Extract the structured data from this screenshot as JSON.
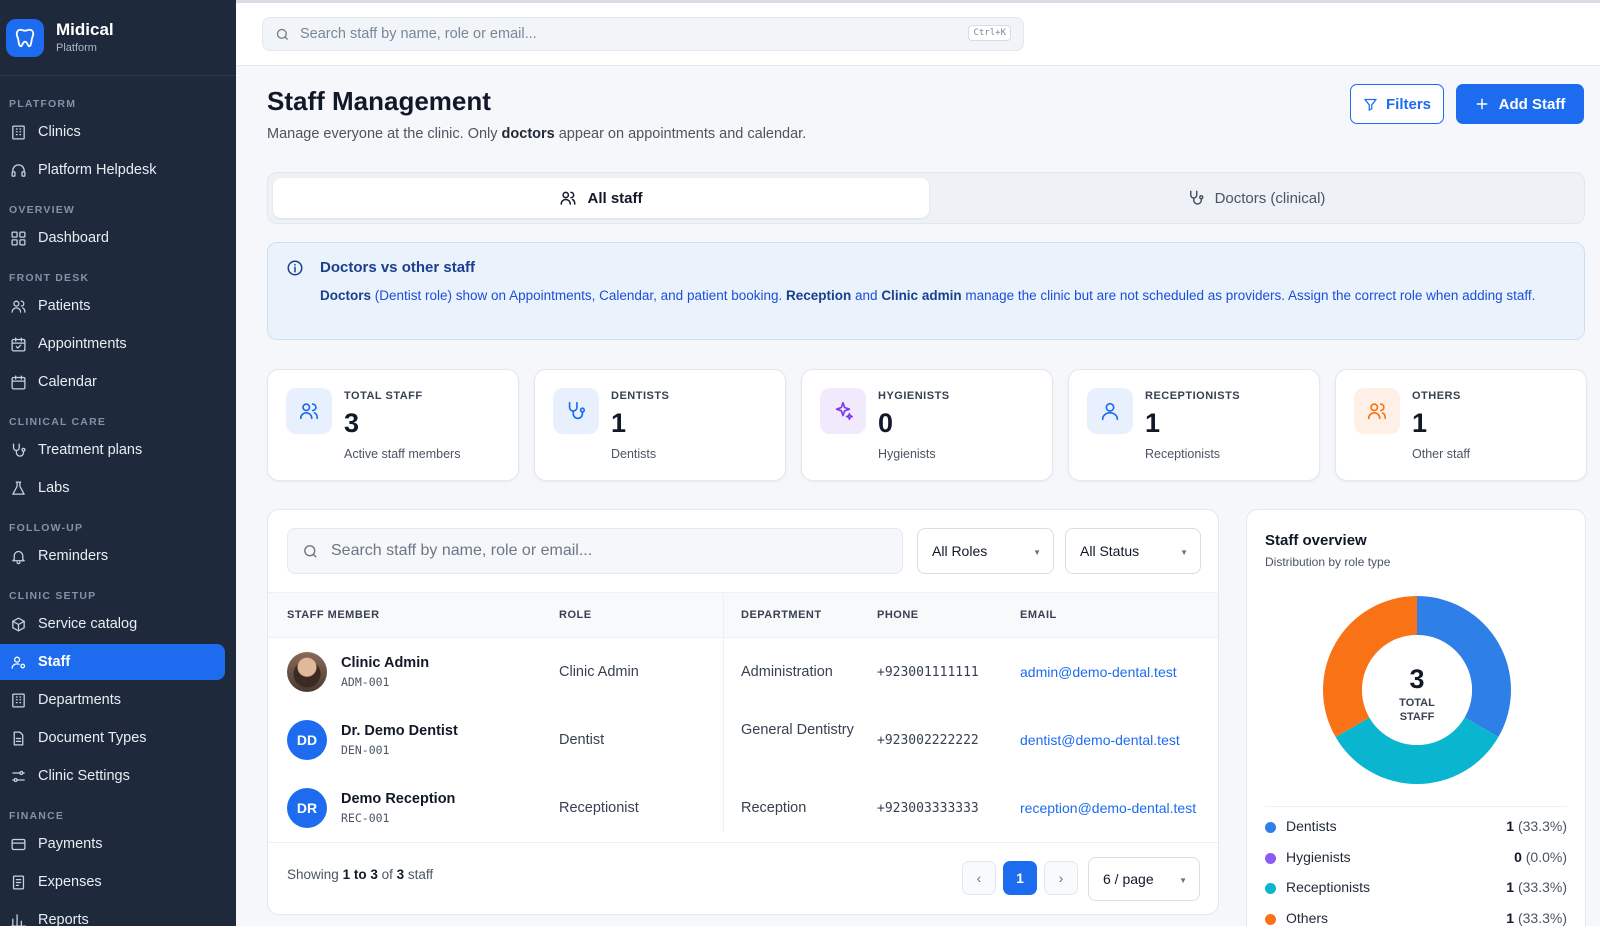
{
  "brand": {
    "name": "Midical",
    "sub": "Platform"
  },
  "sidebar": {
    "groups": [
      {
        "label": "PLATFORM",
        "items": [
          {
            "label": "Clinics",
            "icon": "building-icon"
          },
          {
            "label": "Platform Helpdesk",
            "icon": "headset-icon"
          }
        ]
      },
      {
        "label": "OVERVIEW",
        "items": [
          {
            "label": "Dashboard",
            "icon": "grid-icon"
          }
        ]
      },
      {
        "label": "FRONT DESK",
        "items": [
          {
            "label": "Patients",
            "icon": "users-icon"
          },
          {
            "label": "Appointments",
            "icon": "calendar-check-icon"
          },
          {
            "label": "Calendar",
            "icon": "calendar-icon"
          }
        ]
      },
      {
        "label": "CLINICAL CARE",
        "items": [
          {
            "label": "Treatment plans",
            "icon": "stethoscope-icon"
          },
          {
            "label": "Labs",
            "icon": "flask-icon"
          }
        ]
      },
      {
        "label": "FOLLOW-UP",
        "items": [
          {
            "label": "Reminders",
            "icon": "bell-icon"
          }
        ]
      },
      {
        "label": "CLINIC SETUP",
        "items": [
          {
            "label": "Service catalog",
            "icon": "box-icon"
          },
          {
            "label": "Staff",
            "icon": "user-cog-icon",
            "active": true
          },
          {
            "label": "Departments",
            "icon": "building-icon"
          },
          {
            "label": "Document Types",
            "icon": "file-icon"
          },
          {
            "label": "Clinic Settings",
            "icon": "sliders-icon"
          }
        ]
      },
      {
        "label": "FINANCE",
        "items": [
          {
            "label": "Payments",
            "icon": "card-icon"
          },
          {
            "label": "Expenses",
            "icon": "receipt-icon"
          },
          {
            "label": "Reports",
            "icon": "chart-icon"
          }
        ]
      }
    ]
  },
  "topbar": {
    "search_placeholder": "Search staff by name, role or email...",
    "shortcut": "Ctrl+K"
  },
  "page": {
    "title": "Staff Management",
    "subtitle_pre": "Manage everyone at the clinic. Only ",
    "subtitle_bold": "doctors",
    "subtitle_post": " appear on appointments and calendar.",
    "filters_label": "Filters",
    "add_label": "Add Staff"
  },
  "tabs": {
    "all": "All staff",
    "doctors": "Doctors (clinical)"
  },
  "info": {
    "title": "Doctors vs other staff",
    "b1": "Doctors",
    "t1": " (Dentist role) show on Appointments, Calendar, and patient booking. ",
    "b2": "Reception",
    "t2": " and ",
    "b3": "Clinic admin",
    "t3": " manage the clinic but are not scheduled as providers. Assign the correct role when adding staff."
  },
  "stats": [
    {
      "label": "TOTAL STAFF",
      "value": "3",
      "sub": "Active staff members",
      "icon": "users-icon",
      "color": "#1d6cf0",
      "bg": "#e8f0fd"
    },
    {
      "label": "DENTISTS",
      "value": "1",
      "sub": "Dentists",
      "icon": "stethoscope-icon",
      "color": "#1d6cf0",
      "bg": "#e8f0fd"
    },
    {
      "label": "HYGIENISTS",
      "value": "0",
      "sub": "Hygienists",
      "icon": "sparkles-icon",
      "color": "#7c3aed",
      "bg": "#f1eafd"
    },
    {
      "label": "RECEPTIONISTS",
      "value": "1",
      "sub": "Receptionists",
      "icon": "user-icon",
      "color": "#1d6cf0",
      "bg": "#e8f0fd"
    },
    {
      "label": "OTHERS",
      "value": "1",
      "sub": "Other staff",
      "icon": "users-icon",
      "color": "#f97316",
      "bg": "#fef0e6"
    }
  ],
  "table": {
    "search_placeholder": "Search staff by name, role or email...",
    "role_filter": "All Roles",
    "status_filter": "All Status",
    "columns": {
      "member": "STAFF MEMBER",
      "role": "ROLE",
      "department": "DEPARTMENT",
      "phone": "PHONE",
      "email": "EMAIL"
    },
    "rows": [
      {
        "initials": "",
        "name": "Clinic Admin",
        "code": "ADM-001",
        "role": "Clinic Admin",
        "department": "Administration",
        "phone": "+923001111111",
        "email": "admin@demo-dental.test"
      },
      {
        "initials": "DD",
        "name": "Dr. Demo Dentist",
        "code": "DEN-001",
        "role": "Dentist",
        "department": "General Dentistry",
        "phone": "+923002222222",
        "email": "dentist@demo-dental.test"
      },
      {
        "initials": "DR",
        "name": "Demo Reception",
        "code": "REC-001",
        "role": "Receptionist",
        "department": "Reception",
        "phone": "+923003333333",
        "email": "reception@demo-dental.test"
      }
    ],
    "footer": {
      "showing": "Showing",
      "from": "1 to 3",
      "of": "of",
      "total": "3",
      "unit": "staff",
      "page": "1",
      "per_page": "6 / page"
    }
  },
  "overview": {
    "title": "Staff overview",
    "subtitle": "Distribution by role type",
    "total": "3",
    "total_label_1": "TOTAL",
    "total_label_2": "STAFF",
    "legend": [
      {
        "name": "Dentists",
        "count": "1",
        "pct": "(33.3%)",
        "color": "#2f7fe8"
      },
      {
        "name": "Hygienists",
        "count": "0",
        "pct": "(0.0%)",
        "color": "#8b5cf6"
      },
      {
        "name": "Receptionists",
        "count": "1",
        "pct": "(33.3%)",
        "color": "#0ab5cf"
      },
      {
        "name": "Others",
        "count": "1",
        "pct": "(33.3%)",
        "color": "#f97316"
      }
    ]
  }
}
